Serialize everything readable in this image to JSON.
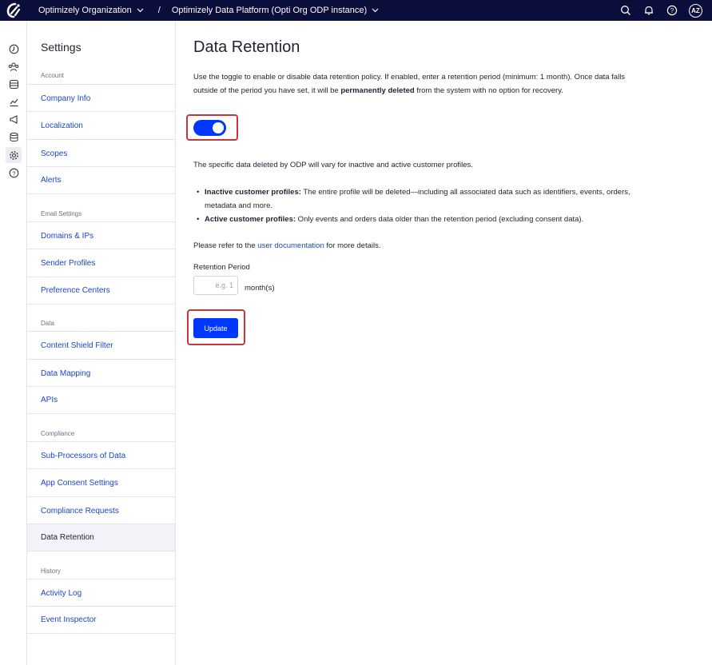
{
  "topbar": {
    "org": "Optimizely Organization",
    "separator": "/",
    "instance": "Optimizely Data Platform (Opti Org ODP instance)",
    "avatar": "AZ",
    "icons": [
      "search-icon",
      "bell-icon",
      "help-icon"
    ]
  },
  "rail": {
    "icons": [
      "dashboard-icon",
      "customers-icon",
      "data-icon",
      "analytics-icon",
      "campaigns-icon",
      "database-icon",
      "settings-icon",
      "help-icon"
    ],
    "active": "settings-icon"
  },
  "sidebar": {
    "title": "Settings",
    "sections": [
      {
        "label": "Account",
        "items": [
          "Company Info",
          "Localization",
          "Scopes",
          "Alerts"
        ]
      },
      {
        "label": "Email Settings",
        "items": [
          "Domains & IPs",
          "Sender Profiles",
          "Preference Centers"
        ]
      },
      {
        "label": "Data",
        "items": [
          "Content Shield Filter",
          "Data Mapping",
          "APIs"
        ]
      },
      {
        "label": "Compliance",
        "items": [
          "Sub-Processors of Data",
          "App Consent Settings",
          "Compliance Requests",
          "Data Retention"
        ]
      },
      {
        "label": "History",
        "items": [
          "Activity Log",
          "Event Inspector"
        ]
      }
    ],
    "active_item": "Data Retention"
  },
  "main": {
    "title": "Data Retention",
    "intro_part1": "Use the toggle to enable or disable data retention policy. If enabled, enter a retention period (minimum: 1 month). Once data falls outside of the period you have set, it will be ",
    "intro_bold": "permanently deleted",
    "intro_part2": " from the system with no option for recovery.",
    "toggle_state": "on",
    "specific_text": "The specific data deleted by ODP will vary for inactive and active customer profiles.",
    "bullets": [
      {
        "bold": "Inactive customer profiles:",
        "text": " The entire profile will be deleted—including all associated data such as identifiers, events, orders, metadata and more."
      },
      {
        "bold": "Active customer profiles:",
        "text": " Only events and orders data older than the retention period (excluding consent data)."
      }
    ],
    "refer_prefix": "Please refer to the ",
    "refer_link": "user documentation",
    "refer_suffix": " for more details.",
    "retention_label": "Retention Period",
    "retention_placeholder": "e.g. 1",
    "retention_value": "",
    "unit": "month(s)",
    "update_label": "Update"
  },
  "colors": {
    "topbar": "#0b0d3a",
    "accent": "#0037ff",
    "link": "#1b46c9",
    "highlight_border": "#c8363d"
  }
}
